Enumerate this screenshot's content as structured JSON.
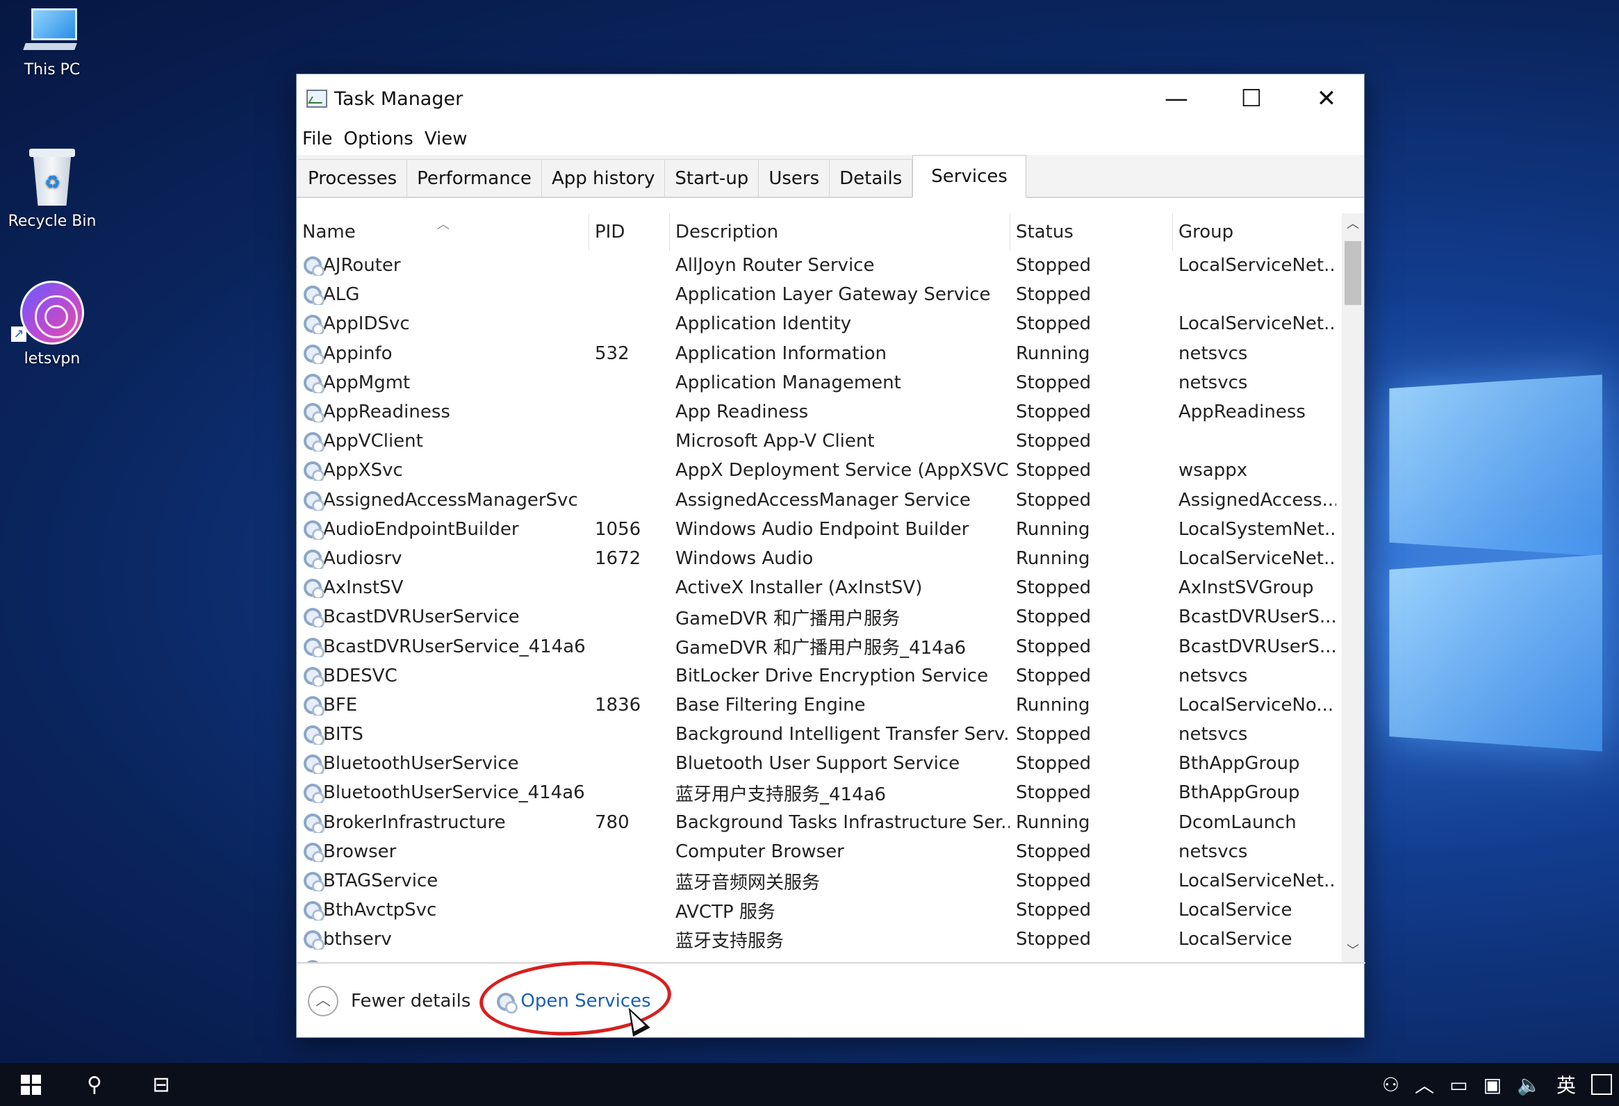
{
  "desktop": {
    "icons": [
      {
        "label": "This PC",
        "icon": "computer-icon"
      },
      {
        "label": "Recycle Bin",
        "icon": "recycle-bin-icon"
      },
      {
        "label": "letsvpn",
        "icon": "letsvpn-icon"
      }
    ]
  },
  "window": {
    "title": "Task Manager",
    "controls": {
      "minimize": "—",
      "maximize": "☐",
      "close": "✕"
    },
    "menu": [
      "File",
      "Options",
      "View"
    ],
    "tabs": [
      "Processes",
      "Performance",
      "App history",
      "Start-up",
      "Users",
      "Details",
      "Services"
    ],
    "active_tab": "Services",
    "table": {
      "columns": [
        "Name",
        "PID",
        "Description",
        "Status",
        "Group"
      ],
      "rows": [
        {
          "name": "AJRouter",
          "pid": "",
          "desc": "AllJoyn Router Service",
          "status": "Stopped",
          "group": "LocalServiceNet..."
        },
        {
          "name": "ALG",
          "pid": "",
          "desc": "Application Layer Gateway Service",
          "status": "Stopped",
          "group": ""
        },
        {
          "name": "AppIDSvc",
          "pid": "",
          "desc": "Application Identity",
          "status": "Stopped",
          "group": "LocalServiceNet..."
        },
        {
          "name": "Appinfo",
          "pid": "532",
          "desc": "Application Information",
          "status": "Running",
          "group": "netsvcs"
        },
        {
          "name": "AppMgmt",
          "pid": "",
          "desc": "Application Management",
          "status": "Stopped",
          "group": "netsvcs"
        },
        {
          "name": "AppReadiness",
          "pid": "",
          "desc": "App Readiness",
          "status": "Stopped",
          "group": "AppReadiness"
        },
        {
          "name": "AppVClient",
          "pid": "",
          "desc": "Microsoft App-V Client",
          "status": "Stopped",
          "group": ""
        },
        {
          "name": "AppXSvc",
          "pid": "",
          "desc": "AppX Deployment Service (AppXSVC)",
          "status": "Stopped",
          "group": "wsappx"
        },
        {
          "name": "AssignedAccessManagerSvc",
          "pid": "",
          "desc": "AssignedAccessManager Service",
          "status": "Stopped",
          "group": "AssignedAccess..."
        },
        {
          "name": "AudioEndpointBuilder",
          "pid": "1056",
          "desc": "Windows Audio Endpoint Builder",
          "status": "Running",
          "group": "LocalSystemNet..."
        },
        {
          "name": "Audiosrv",
          "pid": "1672",
          "desc": "Windows Audio",
          "status": "Running",
          "group": "LocalServiceNet..."
        },
        {
          "name": "AxInstSV",
          "pid": "",
          "desc": "ActiveX Installer (AxInstSV)",
          "status": "Stopped",
          "group": "AxInstSVGroup"
        },
        {
          "name": "BcastDVRUserService",
          "pid": "",
          "desc": "GameDVR 和广播用户服务",
          "status": "Stopped",
          "group": "BcastDVRUserS..."
        },
        {
          "name": "BcastDVRUserService_414a6",
          "pid": "",
          "desc": "GameDVR 和广播用户服务_414a6",
          "status": "Stopped",
          "group": "BcastDVRUserS..."
        },
        {
          "name": "BDESVC",
          "pid": "",
          "desc": "BitLocker Drive Encryption Service",
          "status": "Stopped",
          "group": "netsvcs"
        },
        {
          "name": "BFE",
          "pid": "1836",
          "desc": "Base Filtering Engine",
          "status": "Running",
          "group": "LocalServiceNo..."
        },
        {
          "name": "BITS",
          "pid": "",
          "desc": "Background Intelligent Transfer Serv...",
          "status": "Stopped",
          "group": "netsvcs"
        },
        {
          "name": "BluetoothUserService",
          "pid": "",
          "desc": "Bluetooth User Support Service",
          "status": "Stopped",
          "group": "BthAppGroup"
        },
        {
          "name": "BluetoothUserService_414a6",
          "pid": "",
          "desc": "蓝牙用户支持服务_414a6",
          "status": "Stopped",
          "group": "BthAppGroup"
        },
        {
          "name": "BrokerInfrastructure",
          "pid": "780",
          "desc": "Background Tasks Infrastructure Ser...",
          "status": "Running",
          "group": "DcomLaunch"
        },
        {
          "name": "Browser",
          "pid": "",
          "desc": "Computer Browser",
          "status": "Stopped",
          "group": "netsvcs"
        },
        {
          "name": "BTAGService",
          "pid": "",
          "desc": "蓝牙音频网关服务",
          "status": "Stopped",
          "group": "LocalServiceNet..."
        },
        {
          "name": "BthAvctpSvc",
          "pid": "",
          "desc": "AVCTP 服务",
          "status": "Stopped",
          "group": "LocalService"
        },
        {
          "name": "bthserv",
          "pid": "",
          "desc": "蓝牙支持服务",
          "status": "Stopped",
          "group": "LocalService"
        },
        {
          "name": "",
          "pid": "",
          "desc": "",
          "status": "",
          "group": ""
        }
      ]
    },
    "footer": {
      "fewer_details": "Fewer details",
      "open_services": "Open Services"
    }
  },
  "taskbar": {
    "tray": {
      "input_method": "英"
    }
  },
  "colors": {
    "link": "#1a5fb4",
    "annotation": "#d81f1f"
  }
}
